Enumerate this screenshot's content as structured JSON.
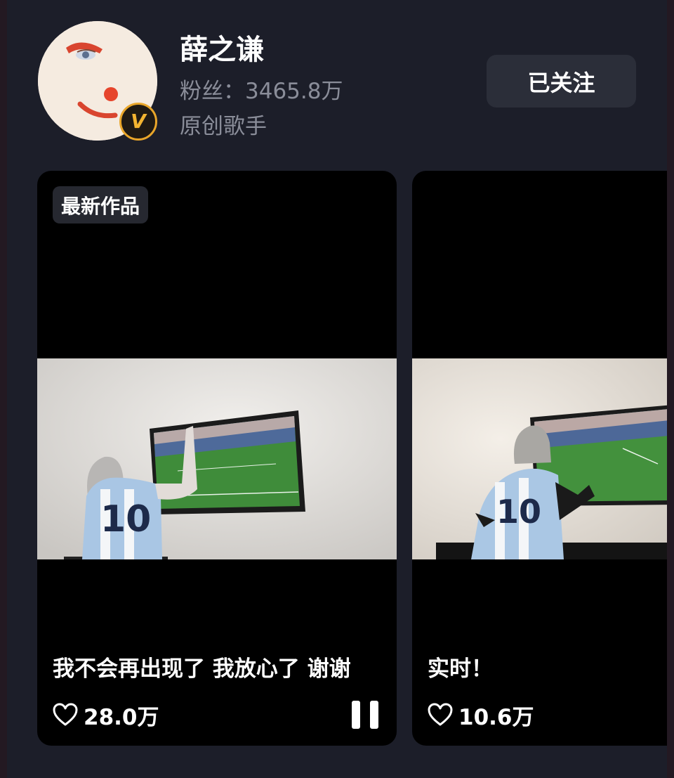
{
  "profile": {
    "name": "薛之谦",
    "fans": "粉丝：3465.8万",
    "title": "原创歌手",
    "follow_label": "已关注"
  },
  "icons": {
    "avatar": "avatar-image",
    "vip": "vip-badge-icon",
    "heart": "heart-outline-icon",
    "pause": "pause-icon"
  },
  "colors": {
    "background": "#1c1e29",
    "card": "#000000",
    "accent_badge": "#e9a62a",
    "secondary_text": "#8a8d99"
  },
  "videos": [
    {
      "badge": "最新作品",
      "caption": "我不会再出现了 我放心了 谢谢",
      "likes": "28.0万",
      "playing": true
    },
    {
      "caption": "实时！",
      "likes": "10.6万"
    }
  ]
}
